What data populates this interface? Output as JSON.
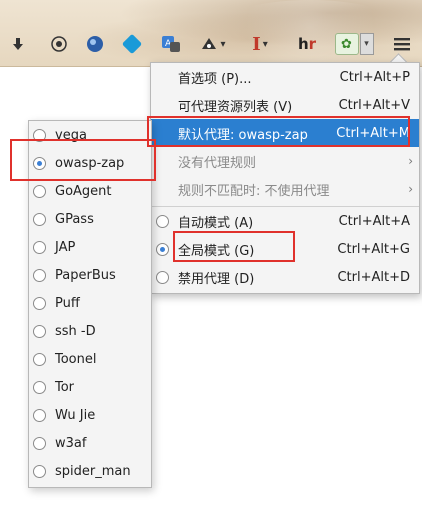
{
  "toolbar": {
    "icons": [
      {
        "name": "download-icon",
        "glyph": "⬇"
      },
      {
        "name": "sync-icon",
        "glyph": "⟳"
      },
      {
        "name": "globe-icon",
        "glyph": "●"
      },
      {
        "name": "cube-icon",
        "glyph": "◆"
      },
      {
        "name": "translate-icon",
        "glyph": "A"
      },
      {
        "name": "proxy-icon",
        "glyph": "✦"
      },
      {
        "name": "text-icon",
        "glyph": "I"
      },
      {
        "name": "hr-icon",
        "glyph": "hr"
      },
      {
        "name": "leaf-icon",
        "glyph": "✿"
      },
      {
        "name": "hamburger-menu-icon",
        "glyph": "≡"
      }
    ]
  },
  "menu": {
    "items": [
      {
        "label": "首选项 (P)...",
        "shortcut": "Ctrl+Alt+P"
      },
      {
        "label": "可代理资源列表 (V)",
        "shortcut": "Ctrl+Alt+V"
      },
      {
        "label": "默认代理: owasp-zap",
        "shortcut": "Ctrl+Alt+M"
      },
      {
        "label": "没有代理规则",
        "shortcut": ""
      },
      {
        "label": "规则不匹配时: 不使用代理",
        "shortcut": ""
      },
      {
        "label": "自动模式 (A)",
        "shortcut": "Ctrl+Alt+A"
      },
      {
        "label": "全局模式 (G)",
        "shortcut": "Ctrl+Alt+G"
      },
      {
        "label": "禁用代理 (D)",
        "shortcut": "Ctrl+Alt+D"
      }
    ],
    "selected_mode": "全局模式 (G)"
  },
  "submenu": {
    "items": [
      "vega",
      "owasp-zap",
      "GoAgent",
      "GPass",
      "JAP",
      "PaperBus",
      "Puff",
      "ssh -D",
      "Toonel",
      "Tor",
      "Wu Jie",
      "w3af",
      "spider_man"
    ],
    "selected": "owasp-zap"
  },
  "colors": {
    "selection": "#2b7fd0",
    "highlight_box": "#e0312c",
    "radio_on": "#3b7fd4"
  }
}
